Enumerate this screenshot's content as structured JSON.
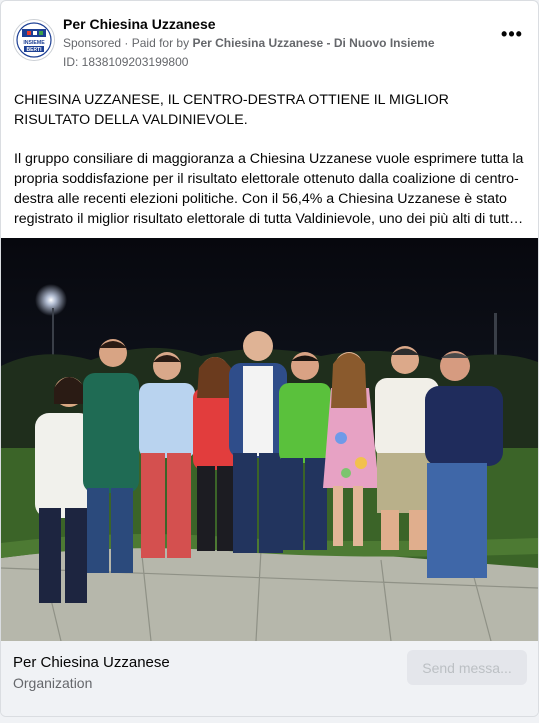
{
  "post": {
    "page_name": "Per Chiesina Uzzanese",
    "sponsored_label": "Sponsored",
    "paid_for_prefix": "· Paid for by",
    "paid_for_by": "Per Chiesina Uzzanese - Di Nuovo Insieme",
    "ad_id": "ID: 1838109203199800",
    "more_icon": "more-horizontal-icon",
    "avatar_text": [
      "INSIEME",
      "BERTI"
    ],
    "headline": "CHIESINA UZZANESE, IL CENTRO-DESTRA OTTIENE IL MIGLIOR RISULTATO DELLA VALDINIEVOLE.",
    "body": "Il gruppo consiliare di maggioranza a Chiesina Uzzanese vuole esprimere tutta la propria soddisfazione per il risultato elettorale ottenuto dalla coalizione di centro-destra alle recenti elezioni politiche. Con il 56,4% a Chiesina Uzzanese è stato registrato il miglior risultato elettorale di tutta Valdinievole, uno dei più alti di tutta la provincia."
  },
  "footer": {
    "name": "Per Chiesina Uzzanese",
    "category": "Organization",
    "cta_label": "Send messa..."
  },
  "colors": {
    "night_sky": "#0b0d14",
    "grass": "#3f6b2c",
    "path": "#b9b9ad",
    "footer_bg": "#f0f2f5"
  }
}
